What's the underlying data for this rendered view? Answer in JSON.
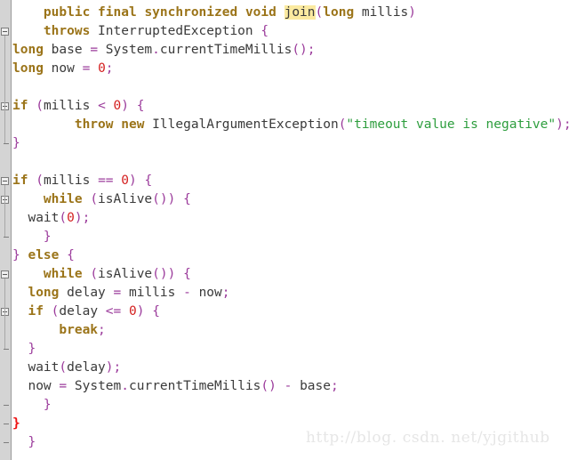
{
  "editor": {
    "language": "java",
    "background_color": "#ffffff",
    "gutter_color": "#d4d4d4",
    "clipped_top_line": "}",
    "colors": {
      "keyword": "#9b7419",
      "punctuation": "#9b3b9b",
      "string": "#2e9e3e",
      "number": "#d42020",
      "identifier": "#3a3a3a",
      "error_brace": "#ee1111",
      "highlight_background": "#fbeaa0"
    }
  },
  "code_lines": [
    {
      "indent": "    ",
      "text": "public final synchronized void join(long millis)"
    },
    {
      "indent": "    ",
      "text": "throws InterruptedException {"
    },
    {
      "indent": "",
      "text": "long base = System.currentTimeMillis();"
    },
    {
      "indent": "",
      "text": "long now = 0;"
    },
    {
      "indent": "",
      "text": ""
    },
    {
      "indent": "",
      "text": "if (millis < 0) {"
    },
    {
      "indent": "        ",
      "text": "throw new IllegalArgumentException(\"timeout value is negative\");"
    },
    {
      "indent": "",
      "text": "}"
    },
    {
      "indent": "",
      "text": ""
    },
    {
      "indent": "",
      "text": "if (millis == 0) {"
    },
    {
      "indent": "    ",
      "text": "while (isAlive()) {"
    },
    {
      "indent": "  ",
      "text": "wait(0);"
    },
    {
      "indent": "    ",
      "text": "}"
    },
    {
      "indent": "",
      "text": "} else {"
    },
    {
      "indent": "    ",
      "text": "while (isAlive()) {"
    },
    {
      "indent": "  ",
      "text": "long delay = millis - now;"
    },
    {
      "indent": "  ",
      "text": "if (delay <= 0) {"
    },
    {
      "indent": "      ",
      "text": "break;"
    },
    {
      "indent": "  ",
      "text": "}"
    },
    {
      "indent": "  ",
      "text": "wait(delay);"
    },
    {
      "indent": "  ",
      "text": "now = System.currentTimeMillis() - base;"
    },
    {
      "indent": "    ",
      "text": "}"
    },
    {
      "indent": "",
      "text": "}"
    },
    {
      "indent": "  ",
      "text": "}"
    }
  ],
  "highlighted_token": "join",
  "watermark": {
    "text": "http://blog. csdn. net/yjgithub"
  },
  "gutter": {
    "fold_markers": [
      {
        "type": "fold-open",
        "line_index": 1
      },
      {
        "type": "fold-open",
        "line_index": 5
      },
      {
        "type": "fold-end",
        "line_index": 7
      },
      {
        "type": "fold-open",
        "line_index": 9
      },
      {
        "type": "fold-open",
        "line_index": 10
      },
      {
        "type": "fold-end",
        "line_index": 12
      },
      {
        "type": "fold-open",
        "line_index": 14
      },
      {
        "type": "fold-open",
        "line_index": 16
      },
      {
        "type": "fold-end",
        "line_index": 18
      },
      {
        "type": "fold-end",
        "line_index": 21
      },
      {
        "type": "fold-end",
        "line_index": 22
      },
      {
        "type": "fold-end",
        "line_index": 23
      }
    ]
  }
}
